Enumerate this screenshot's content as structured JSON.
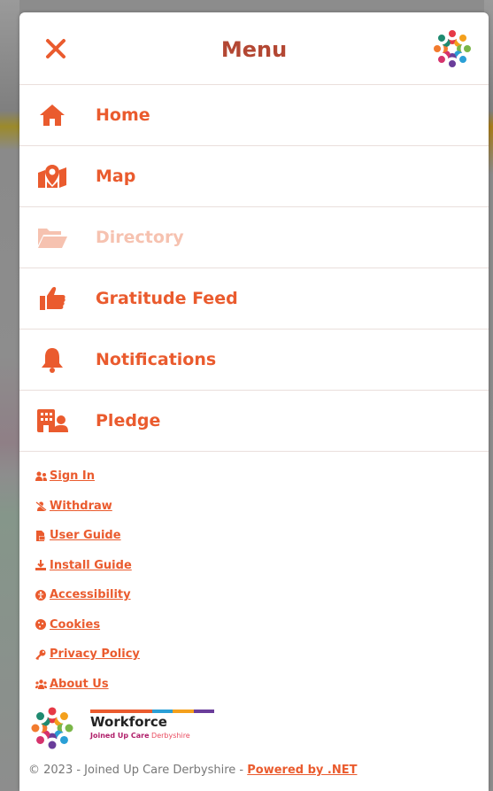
{
  "header": {
    "title": "Menu",
    "close_icon": "close-icon",
    "logo": "joined-up-care-logo"
  },
  "nav": [
    {
      "label": "Home",
      "icon": "home-icon"
    },
    {
      "label": "Map",
      "icon": "map-icon"
    },
    {
      "label": "Directory",
      "icon": "folder-open-icon",
      "disabled": true
    },
    {
      "label": "Gratitude Feed",
      "icon": "thumbs-up-icon"
    },
    {
      "label": "Notifications",
      "icon": "bell-icon"
    },
    {
      "label": "Pledge",
      "icon": "building-user-icon"
    }
  ],
  "links": [
    {
      "label": "Sign In",
      "icon": "users-icon"
    },
    {
      "label": "Withdraw",
      "icon": "user-slash-icon"
    },
    {
      "label": "User Guide",
      "icon": "file-pdf-icon"
    },
    {
      "label": "Install Guide",
      "icon": "download-icon"
    },
    {
      "label": "Accessibility",
      "icon": "accessibility-icon"
    },
    {
      "label": "Cookies",
      "icon": "cookie-icon"
    },
    {
      "label": "Privacy Policy",
      "icon": "key-icon"
    },
    {
      "label": "About Us",
      "icon": "users-group-icon"
    }
  ],
  "brand": {
    "name": "Workforce",
    "sub_bold": "Joined Up Care",
    "sub_rest": " Derbyshire"
  },
  "footer": {
    "copyright": "© 2023 - Joined Up Care Derbyshire - ",
    "powered": "Powered by .NET"
  },
  "colors": {
    "accent": "#ea5b2e",
    "title": "#b34733",
    "disabled": "#f6c2b0"
  }
}
